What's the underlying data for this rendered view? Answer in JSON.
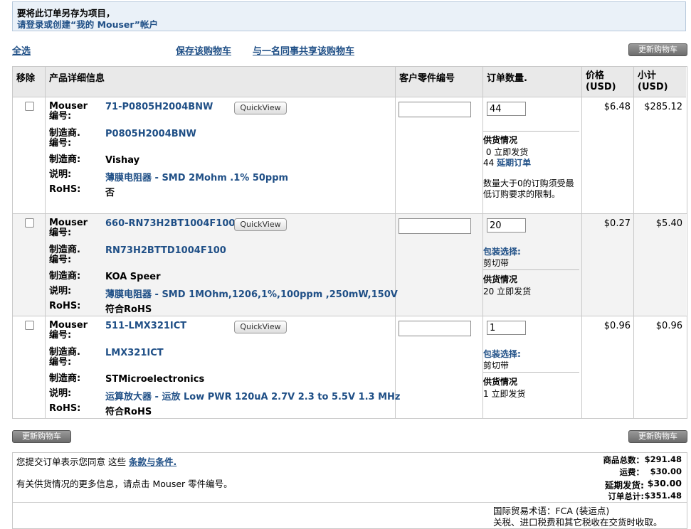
{
  "notice": {
    "line1": "要将此订单另存为项目，",
    "line2": "请登录或创建“我的 Mouser”帐户"
  },
  "toolbar": {
    "select_all": "全选",
    "save_cart": "保存该购物车",
    "share_cart": "与一名同事共享该购物车",
    "update_cart": "更新购物车"
  },
  "table": {
    "headers": {
      "remove": "移除",
      "details": "产品详细信息",
      "customer_part": "客户零件编号",
      "qty": "订单数量.",
      "price": "价格\n(USD)",
      "subtotal": "小计\n(USD)"
    },
    "labels": {
      "mouser_no": "Mouser\n编号:",
      "mfr_no": "制造商.\n编号:",
      "mfr": "制造商:",
      "desc": "说明:",
      "rohs": "RoHS:"
    },
    "quickview": "QuickView",
    "rows": [
      {
        "mouser_no": "71-P0805H2004BNW",
        "mfr_no": "P0805H2004BNW",
        "mfr": "Vishay",
        "desc": "薄膜电阻器 - SMD 2Mohm .1% 50ppm",
        "rohs": "否",
        "qty": "44",
        "avail_title": "供货情况",
        "avail_line1": " 0 立即发货",
        "avail_line2_num": "44",
        "avail_line2_text": "延期订单",
        "note": "数量大于0的订购须受最低订购要求的限制。",
        "price": "$6.48",
        "subtotal": "$285.12"
      },
      {
        "mouser_no": "660-RN73H2BT1004F100",
        "mfr_no": "RN73H2BTTD1004F100",
        "mfr": "KOA Speer",
        "desc": "薄膜电阻器 - SMD 1MOhm,1206,1%,100ppm ,250mW,150V",
        "rohs": "符合RoHS",
        "qty": "20",
        "pack_title": "包装选择:",
        "pack_value": "剪切带",
        "avail_title": "供货情况",
        "avail_line1": "20 立即发货",
        "price": "$0.27",
        "subtotal": "$5.40"
      },
      {
        "mouser_no": "511-LMX321ICT",
        "mfr_no": "LMX321ICT",
        "mfr": "STMicroelectronics",
        "desc": "运算放大器 - 运放 Low PWR 120uA 2.7V 2.3 to 5.5V 1.3 MHz",
        "rohs": "符合RoHS",
        "qty": "1",
        "pack_title": "包装选择:",
        "pack_value": "剪切带",
        "avail_title": "供货情况",
        "avail_line1": "1 立即发货",
        "price": "$0.96",
        "subtotal": "$0.96"
      }
    ]
  },
  "footer": {
    "terms_prefix": "您提交订单表示您同意 这些 ",
    "terms_link": "条款与条件.",
    "availability_info": "有关供货情况的更多信息，请点击 Mouser 零件编号。",
    "totals": [
      {
        "label": "商品总数：",
        "value": "$291.48"
      },
      {
        "label": "运费：",
        "value": "$30.00"
      },
      {
        "label": "延期发货:",
        "value": "$30.00"
      },
      {
        "label": "订单总计:",
        "value": "$351.48"
      }
    ],
    "incoterm": "国际贸易术语：FCA (装运点)",
    "duties": "关税、进口税费和其它税收在交货时收取。"
  }
}
